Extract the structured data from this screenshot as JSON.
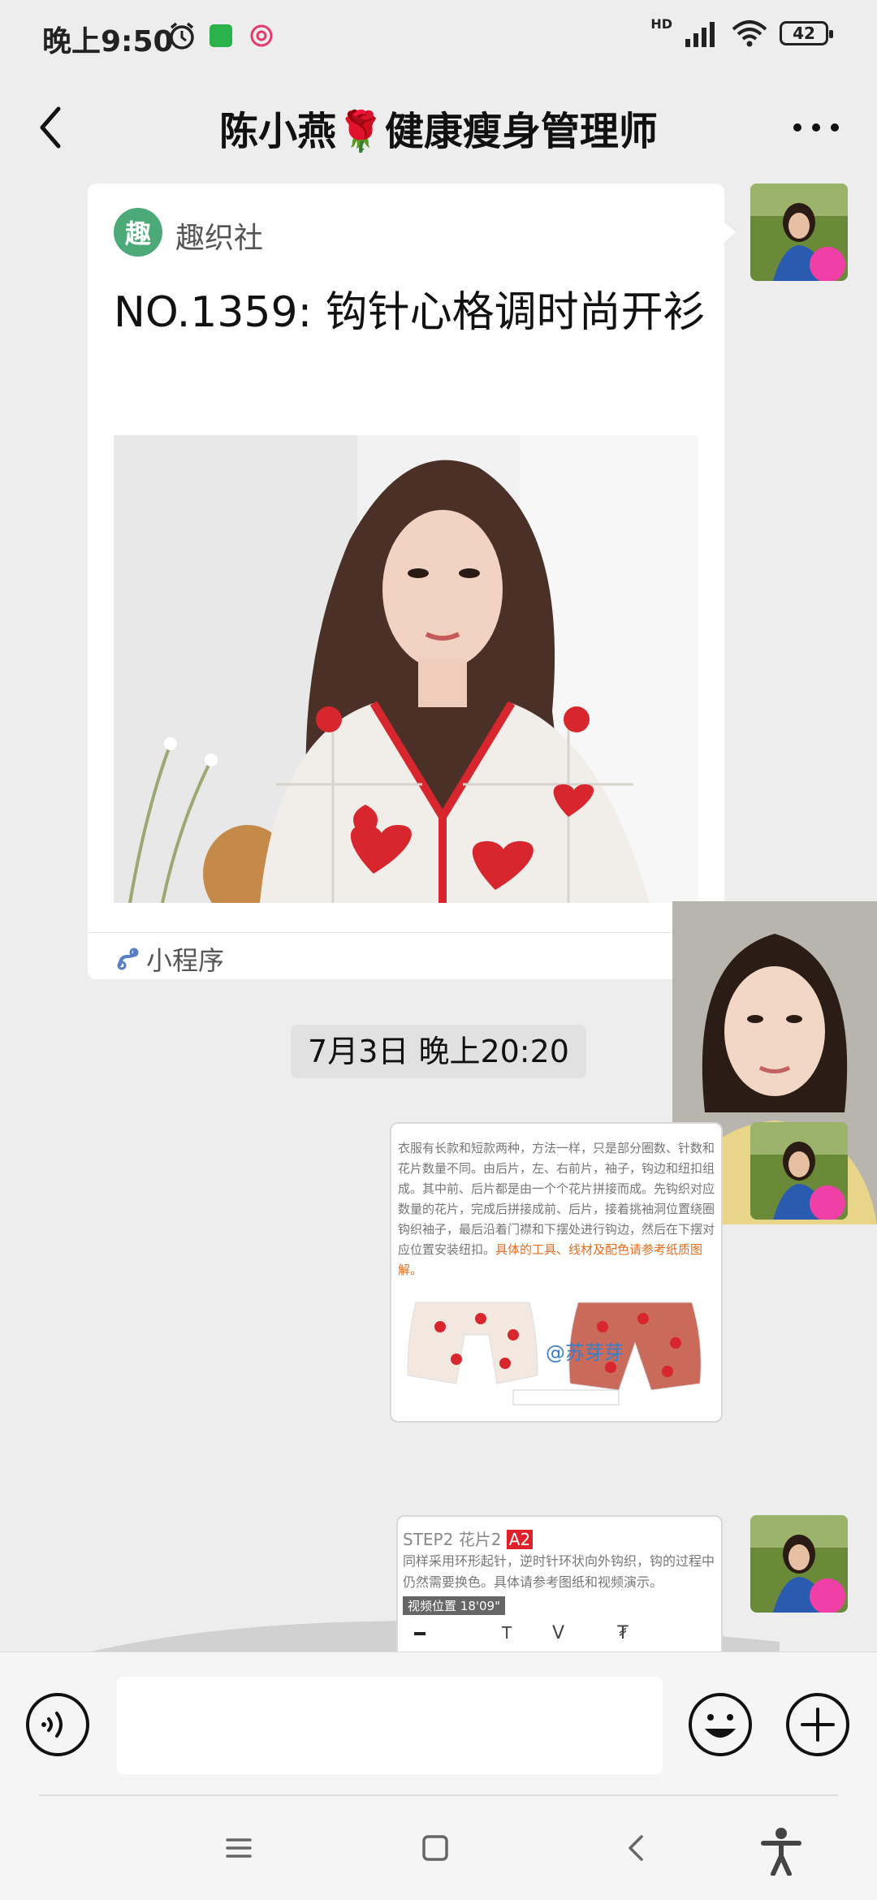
{
  "status_bar": {
    "time": "晚上9:50",
    "network": "HD",
    "battery": "42"
  },
  "header": {
    "title": "陈小燕🌹健康瘦身管理师"
  },
  "card": {
    "source": "趣织社",
    "logo_char": "趣",
    "title": "NO.1359: 钩针心格调时尚开衫",
    "footer": "小程序"
  },
  "timestamp": "7月3日 晚上20:20",
  "doc1": {
    "text": "衣服有长款和短款两种，方法一样，只是部分圈数、针数和花片数量不同。由后片，左、右前片，袖子，钩边和纽扣组成。其中前、后片都是由一个个花片拼接而成。先钩织对应数量的花片，完成后拼接成前、后片，接着挑袖洞位置绕圈钩织袖子，最后沿着门襟和下摆处进行钩边，然后在下摆对应位置安装纽扣。",
    "orange": "具体的工具、线材及配色请参考纸质图解。",
    "watermark": "@苏芽芽"
  },
  "doc2": {
    "step": "STEP2 花片2",
    "badge": "A2",
    "text": "同样采用环形起针，逆时针环状向外钩织，钩的过程中仍然需要换色。具体请参考图纸和视频演示。",
    "video_label": "视频位置",
    "video_time": "18'09\""
  },
  "colors": {
    "background": "#ededed",
    "card": "#ffffff",
    "logo_green": "#4caa79",
    "accent_red": "#e0202a"
  }
}
